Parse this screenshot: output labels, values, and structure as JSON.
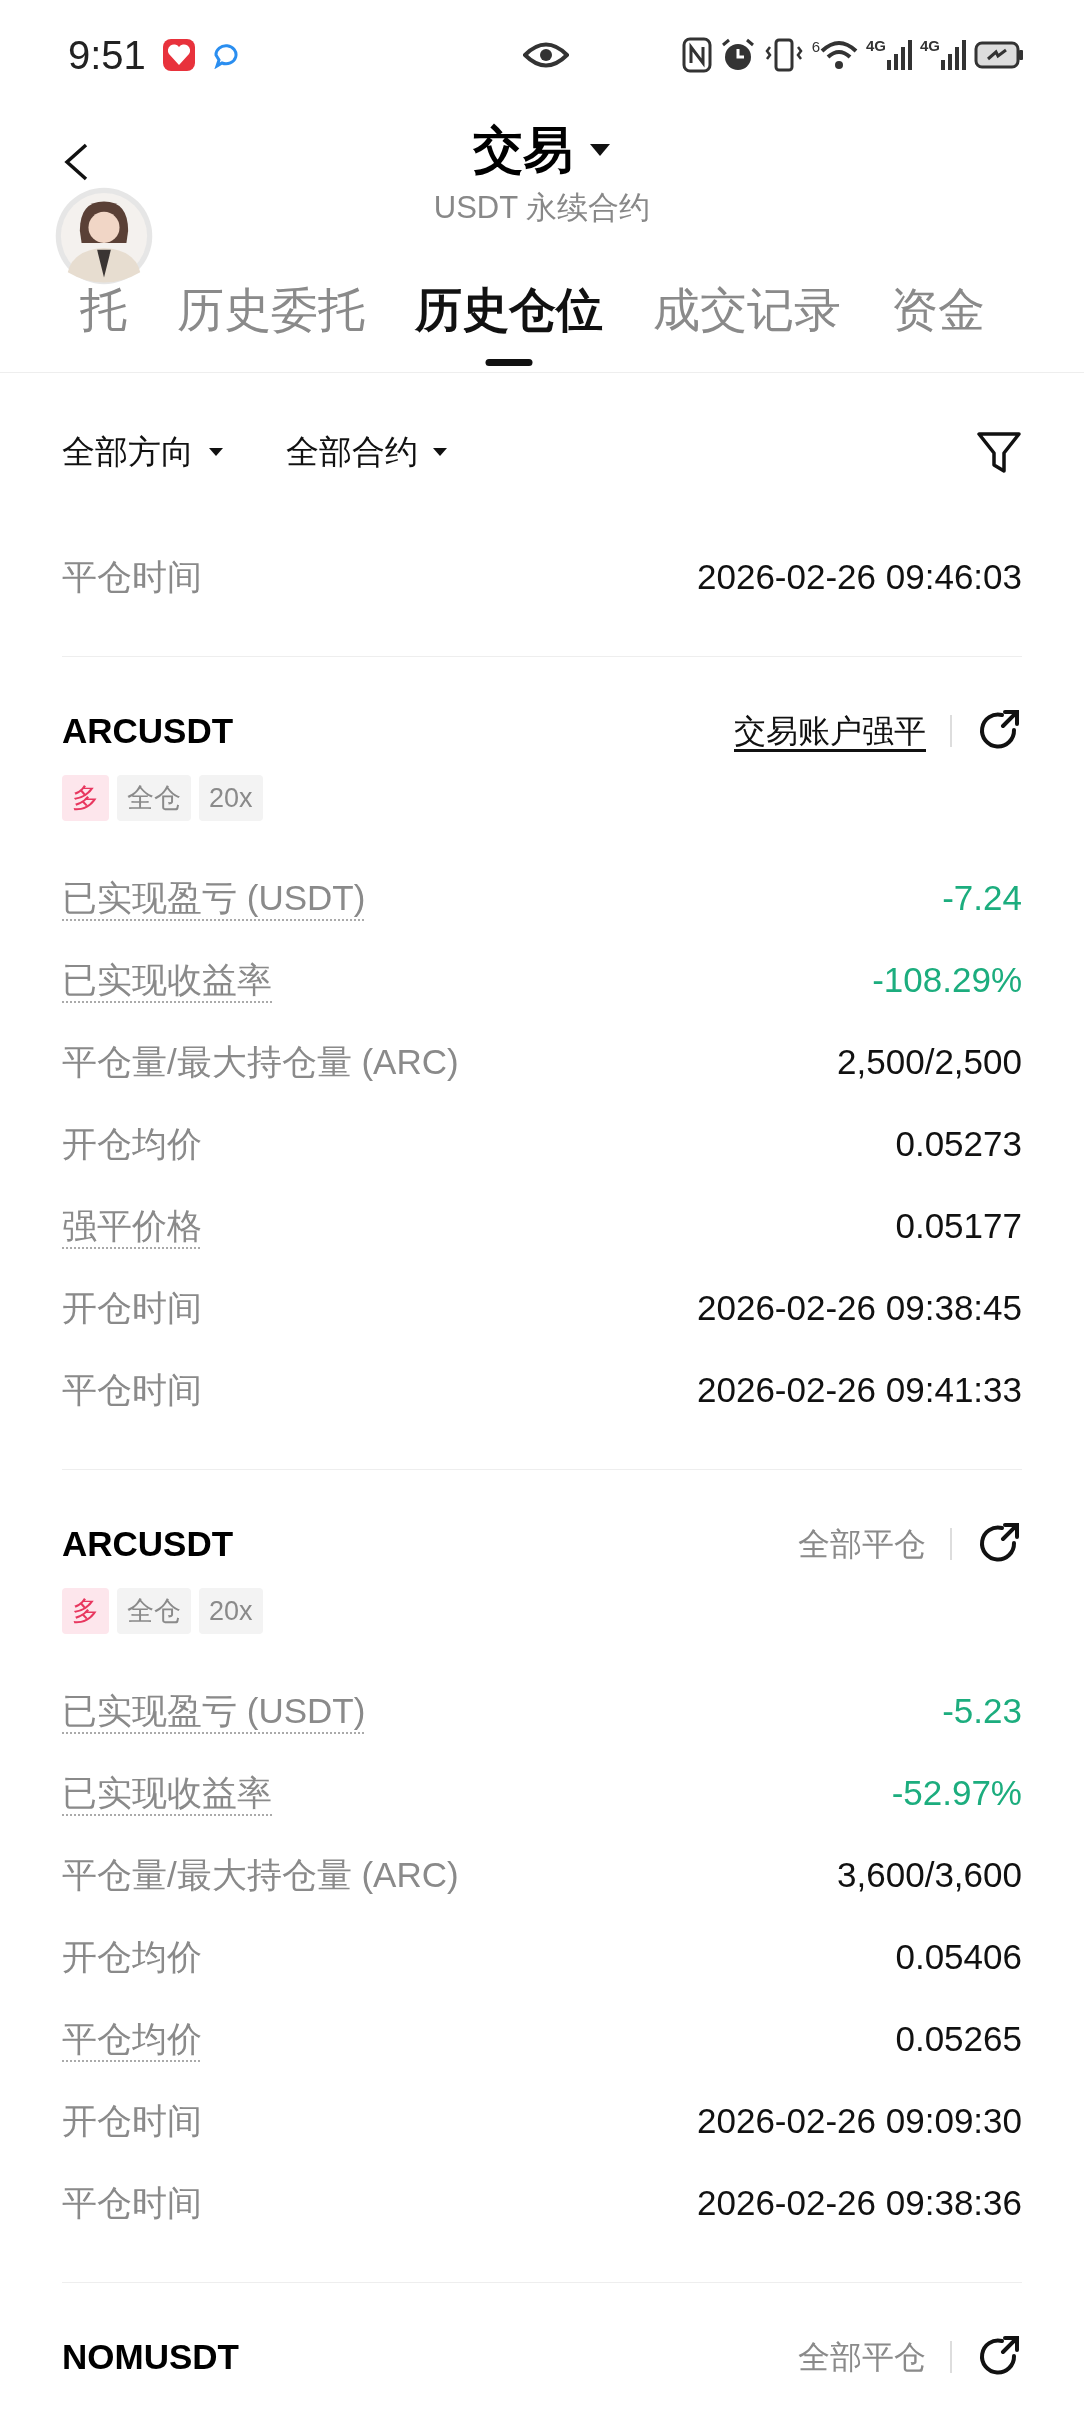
{
  "status_bar": {
    "time": "9:51",
    "wifi_label": "6",
    "signals": [
      "4G",
      "4G"
    ]
  },
  "header": {
    "title": "交易",
    "subtitle": "USDT 永续合约"
  },
  "tabs": [
    {
      "label": "托",
      "selected": false
    },
    {
      "label": "历史委托",
      "selected": false
    },
    {
      "label": "历史仓位",
      "selected": true
    },
    {
      "label": "成交记录",
      "selected": false
    },
    {
      "label": "资金",
      "selected": false
    }
  ],
  "filters": [
    {
      "label": "全部方向"
    },
    {
      "label": "全部合约"
    }
  ],
  "partial_rows": [
    {
      "label": "平仓时间",
      "value": "2026-02-26 09:46:03",
      "dotted": false
    }
  ],
  "positions": [
    {
      "symbol": "ARCUSDT",
      "status": "交易账户强平",
      "underlined": true,
      "tags": [
        {
          "label": "多",
          "kind": "side"
        },
        {
          "label": "全仓",
          "kind": "mode"
        },
        {
          "label": "20x",
          "kind": "mode"
        }
      ],
      "rows": [
        {
          "label": "已实现盈亏 (USDT)",
          "value": "-7.24",
          "dotted": true,
          "kind": "pnl"
        },
        {
          "label": "已实现收益率",
          "value": "-108.29%",
          "dotted": true,
          "kind": "pnl"
        },
        {
          "label": "平仓量/最大持仓量 (ARC)",
          "value": "2,500/2,500",
          "dotted": false,
          "kind": "plain"
        },
        {
          "label": "开仓均价",
          "value": "0.05273",
          "dotted": false,
          "kind": "plain"
        },
        {
          "label": "强平价格",
          "value": "0.05177",
          "dotted": true,
          "kind": "plain"
        },
        {
          "label": "开仓时间",
          "value": "2026-02-26 09:38:45",
          "dotted": false,
          "kind": "plain"
        },
        {
          "label": "平仓时间",
          "value": "2026-02-26 09:41:33",
          "dotted": false,
          "kind": "plain"
        }
      ]
    },
    {
      "symbol": "ARCUSDT",
      "status": "全部平仓",
      "underlined": false,
      "tags": [
        {
          "label": "多",
          "kind": "side"
        },
        {
          "label": "全仓",
          "kind": "mode"
        },
        {
          "label": "20x",
          "kind": "mode"
        }
      ],
      "rows": [
        {
          "label": "已实现盈亏 (USDT)",
          "value": "-5.23",
          "dotted": true,
          "kind": "pnl"
        },
        {
          "label": "已实现收益率",
          "value": "-52.97%",
          "dotted": true,
          "kind": "pnl"
        },
        {
          "label": "平仓量/最大持仓量 (ARC)",
          "value": "3,600/3,600",
          "dotted": false,
          "kind": "plain"
        },
        {
          "label": "开仓均价",
          "value": "0.05406",
          "dotted": false,
          "kind": "plain"
        },
        {
          "label": "平仓均价",
          "value": "0.05265",
          "dotted": true,
          "kind": "plain"
        },
        {
          "label": "开仓时间",
          "value": "2026-02-26 09:09:30",
          "dotted": false,
          "kind": "plain"
        },
        {
          "label": "平仓时间",
          "value": "2026-02-26 09:38:36",
          "dotted": false,
          "kind": "plain"
        }
      ]
    },
    {
      "symbol": "NOMUSDT",
      "status": "全部平仓",
      "underlined": false
    }
  ]
}
